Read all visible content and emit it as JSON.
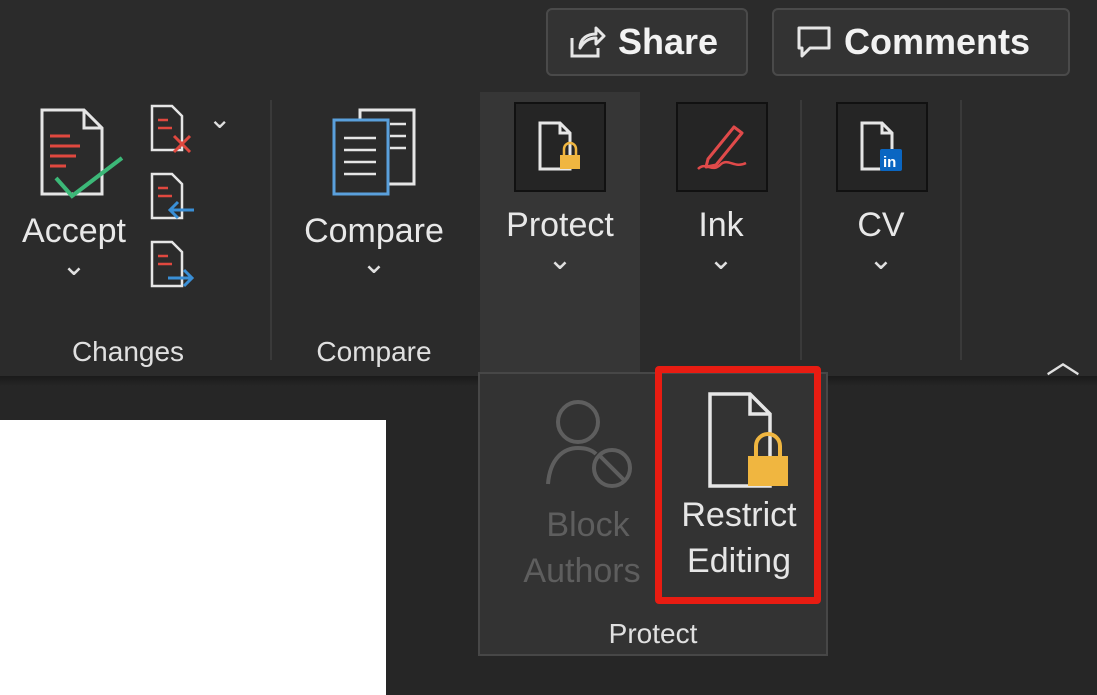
{
  "top_buttons": {
    "share": {
      "label": "Share",
      "icon": "share-icon"
    },
    "comments": {
      "label": "Comments",
      "icon": "comment-icon"
    }
  },
  "ribbon": {
    "groups": {
      "changes": "Changes",
      "compare": "Compare"
    },
    "buttons": {
      "accept": "Accept",
      "compare": "Compare",
      "protect": "Protect",
      "ink": "Ink",
      "cv": "CV"
    },
    "chevron": "⌄",
    "collapse": "︿"
  },
  "protect_dropdown": {
    "block_authors": {
      "line1": "Block",
      "line2": "Authors",
      "enabled": false
    },
    "restrict_editing": {
      "line1": "Restrict",
      "line2": "Editing",
      "highlighted": true
    },
    "group_label": "Protect"
  },
  "colors": {
    "highlight": "#e81c12",
    "lock": "#f0b640",
    "linkedin": "#0a66c2",
    "accept_check": "#3cb878",
    "reject_x": "#e0483f",
    "ink_pen": "#e04a4a"
  }
}
